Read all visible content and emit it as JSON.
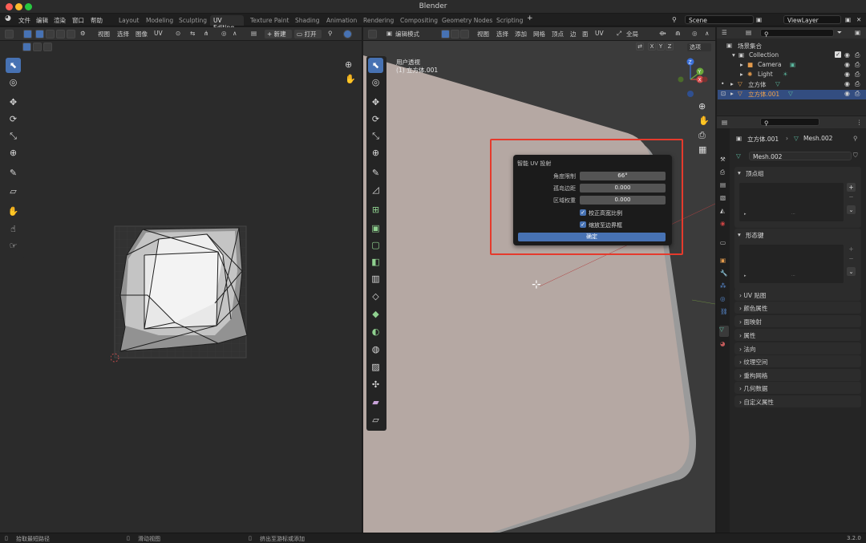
{
  "window": {
    "title": "Blender"
  },
  "menu": {
    "items": [
      "文件",
      "编辑",
      "渲染",
      "窗口",
      "帮助"
    ]
  },
  "workspaces": [
    "Layout",
    "Modeling",
    "Sculpting",
    "UV Editing",
    "Texture Paint",
    "Shading",
    "Animation",
    "Rendering",
    "Compositing",
    "Geometry Nodes",
    "Scripting"
  ],
  "active_workspace": "UV Editing",
  "scene": {
    "name": "Scene",
    "view_layer": "ViewLayer"
  },
  "uv_editor": {
    "menus": [
      "视图",
      "选择",
      "图像",
      "UV"
    ],
    "new_label": "新建",
    "open_label": "打开"
  },
  "viewport": {
    "mode": "编辑模式",
    "menus": [
      "视图",
      "选择",
      "添加",
      "网格",
      "顶点",
      "边",
      "面",
      "UV"
    ],
    "transform": "全局",
    "options": "选项",
    "overlay_title": "用户透视",
    "overlay_object": "(1) 立方体.001",
    "axes": [
      "X",
      "Y",
      "Z"
    ]
  },
  "dialog": {
    "title": "智能 UV 投射",
    "angle_label": "角度限制",
    "angle_value": "66°",
    "margin_label": "孤岛边距",
    "margin_value": "0.000",
    "weight_label": "区域权重",
    "weight_value": "0.000",
    "aspect_label": "校正高宽比例",
    "bounds_label": "缩放至边界框",
    "ok_label": "确定"
  },
  "outliner": {
    "root": "场景集合",
    "collection": "Collection",
    "items": [
      "Camera",
      "Light",
      "立方体",
      "立方体.001"
    ]
  },
  "properties": {
    "object": "立方体.001",
    "mesh": "Mesh.002",
    "mesh_field": "Mesh.002",
    "vertex_groups": "顶点组",
    "shape_keys": "形态键",
    "sections": [
      "UV 贴图",
      "颜色属性",
      "面映射",
      "属性",
      "法向",
      "纹理空间",
      "重构网格",
      "几何数据",
      "自定义属性"
    ]
  },
  "status": {
    "left": "拾取最短路径",
    "mid": "滑动视图",
    "right": "挤出至游标或添加",
    "version": "3.2.0"
  }
}
